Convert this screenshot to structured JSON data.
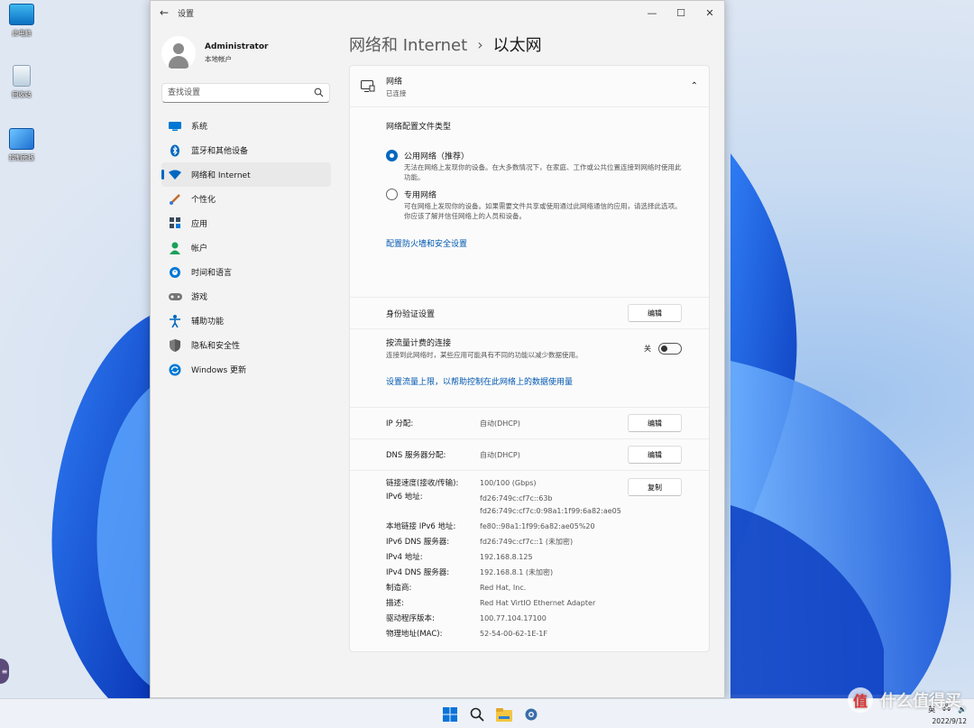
{
  "desktop": {
    "icons": [
      {
        "label": "此电脑",
        "icon": "computer-icon"
      },
      {
        "label": "回收站",
        "icon": "recycle-bin-icon"
      },
      {
        "label": "控制面板",
        "icon": "control-panel-icon"
      }
    ]
  },
  "window": {
    "title": "设置",
    "controls": {
      "minimize": "—",
      "maximize": "☐",
      "close": "✕"
    }
  },
  "profile": {
    "name": "Administrator",
    "subtitle": "本地帐户"
  },
  "search": {
    "placeholder": "查找设置"
  },
  "sidebar": {
    "items": [
      {
        "label": "系统",
        "icon": "monitor-icon",
        "color": "#0078d4"
      },
      {
        "label": "蓝牙和其他设备",
        "icon": "bluetooth-icon",
        "color": "#0067c0"
      },
      {
        "label": "网络和 Internet",
        "icon": "wifi-icon",
        "color": "#0067c0",
        "active": true
      },
      {
        "label": "个性化",
        "icon": "brush-icon",
        "color": "#c26b2b"
      },
      {
        "label": "应用",
        "icon": "apps-icon",
        "color": "#3a4a5c"
      },
      {
        "label": "帐户",
        "icon": "person-icon",
        "color": "#1aa05a"
      },
      {
        "label": "时间和语言",
        "icon": "globe-clock-icon",
        "color": "#0078d4"
      },
      {
        "label": "游戏",
        "icon": "gamepad-icon",
        "color": "#666666"
      },
      {
        "label": "辅助功能",
        "icon": "accessibility-icon",
        "color": "#0067c0"
      },
      {
        "label": "隐私和安全性",
        "icon": "shield-icon",
        "color": "#6a6a6a"
      },
      {
        "label": "Windows 更新",
        "icon": "update-icon",
        "color": "#0078d4"
      }
    ]
  },
  "breadcrumb": {
    "parent": "网络和 Internet",
    "separator": "›",
    "current": "以太网"
  },
  "network_card": {
    "title": "网络",
    "status": "已连接",
    "profile_type_title": "网络配置文件类型",
    "public": {
      "label": "公用网络（推荐）",
      "desc": "无法在网络上发现你的设备。在大多数情况下，在家庭、工作或公共位置连接到网络时使用此功能。",
      "selected": true
    },
    "private": {
      "label": "专用网络",
      "desc": "可在网络上发现你的设备。如果需要文件共享或使用通过此网络通信的应用，请选择此选项。你应该了解并信任网络上的人员和设备。",
      "selected": false
    },
    "firewall_link": "配置防火墙和安全设置"
  },
  "auth": {
    "label": "身份验证设置",
    "button": "编辑"
  },
  "metered": {
    "label": "按流量计费的连接",
    "desc": "连接到此网络时，某些应用可能具有不同的功能以减少数据使用。",
    "state_label": "关",
    "on": false,
    "link": "设置流量上限，以帮助控制在此网络上的数据使用量"
  },
  "ip": {
    "label": "IP 分配:",
    "value": "自动(DHCP)",
    "button": "编辑"
  },
  "dns": {
    "label": "DNS 服务器分配:",
    "value": "自动(DHCP)",
    "button": "编辑"
  },
  "properties": {
    "copy_button": "复制",
    "rows": [
      {
        "label": "链接速度(接收/传输):",
        "value": "100/100 (Gbps)"
      },
      {
        "label": "IPv6 地址:",
        "value": "fd26:749c:cf7c::63b"
      },
      {
        "label": "",
        "value": "fd26:749c:cf7c:0:98a1:1f99:6a82:ae05"
      },
      {
        "label": "本地链接 IPv6 地址:",
        "value": "fe80::98a1:1f99:6a82:ae05%20"
      },
      {
        "label": "IPv6 DNS 服务器:",
        "value": "fd26:749c:cf7c::1 (未加密)"
      },
      {
        "label": "IPv4 地址:",
        "value": "192.168.8.125"
      },
      {
        "label": "IPv4 DNS 服务器:",
        "value": "192.168.8.1 (未加密)"
      },
      {
        "label": "制造商:",
        "value": "Red Hat, Inc."
      },
      {
        "label": "描述:",
        "value": "Red Hat VirtIO Ethernet Adapter"
      },
      {
        "label": "驱动程序版本:",
        "value": "100.77.104.17100"
      },
      {
        "label": "物理地址(MAC):",
        "value": "52-54-00-62-1E-1F"
      }
    ]
  },
  "taskbar": {
    "icons": [
      "windows-start-icon",
      "search-icon",
      "file-explorer-icon",
      "settings-icon"
    ],
    "ime": "英",
    "date": "2022/9/12"
  },
  "watermark": {
    "text": "什么值得买",
    "badge": "值"
  },
  "colors": {
    "accent": "#0067c0",
    "link": "#0057b0",
    "bloom": "#0a4fd6"
  }
}
